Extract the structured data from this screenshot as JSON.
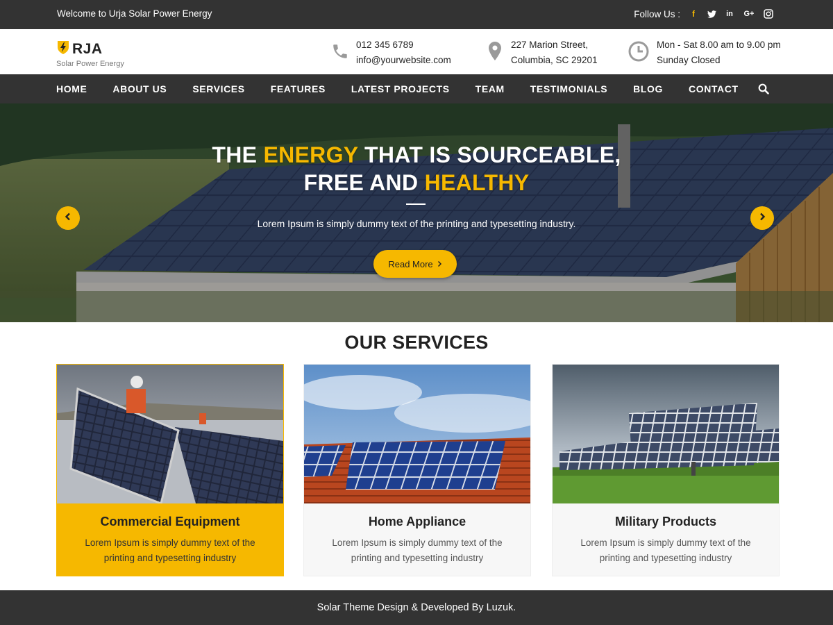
{
  "topbar": {
    "welcome": "Welcome to Urja Solar Power Energy",
    "follow_label": "Follow Us :",
    "social": [
      {
        "icon": "facebook-icon",
        "glyph": "f"
      },
      {
        "icon": "twitter-icon",
        "glyph": "t"
      },
      {
        "icon": "linkedin-icon",
        "glyph": "in"
      },
      {
        "icon": "google-plus-icon",
        "glyph": "G+"
      },
      {
        "icon": "instagram-icon",
        "glyph": ""
      }
    ]
  },
  "header": {
    "logo_name": "RJA",
    "logo_tagline": "Solar Power Energy",
    "phone": "012 345 6789",
    "email": "info@yourwebsite.com",
    "address_line1": "227 Marion Street,",
    "address_line2": "Columbia, SC 29201",
    "hours_line1": "Mon - Sat 8.00 am to 9.00 pm",
    "hours_line2": "Sunday Closed"
  },
  "nav": {
    "items": [
      "HOME",
      "ABOUT US",
      "SERVICES",
      "FEATURES",
      "LATEST PROJECTS",
      "TEAM",
      "TESTIMONIALS",
      "BLOG",
      "CONTACT"
    ]
  },
  "hero": {
    "title_part1": "THE ",
    "title_highlight1": "ENERGY",
    "title_part2": " THAT IS SOURCEABLE,",
    "title_part3": "FREE AND ",
    "title_highlight2": "HEALTHY",
    "subtitle": "Lorem Ipsum is simply dummy text of the printing and typesetting industry.",
    "button_label": "Read More"
  },
  "services": {
    "title": "OUR SERVICES",
    "cards": [
      {
        "title": "Commercial Equipment",
        "description": "Lorem Ipsum is simply dummy text of the printing and typesetting industry"
      },
      {
        "title": "Home Appliance",
        "description": "Lorem Ipsum is simply dummy text of the printing and typesetting industry"
      },
      {
        "title": "Military Products",
        "description": "Lorem Ipsum is simply dummy text of the printing and typesetting industry"
      }
    ]
  },
  "footer": {
    "credit": "Solar Theme Design & Developed By Luzuk."
  },
  "colors": {
    "accent": "#f6b800",
    "dark_bar": "#333333"
  }
}
